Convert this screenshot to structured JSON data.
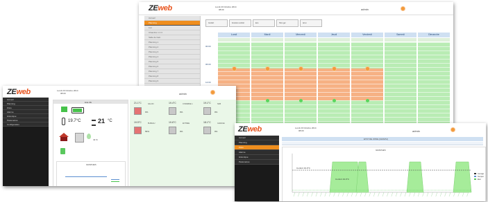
{
  "brand": {
    "ze": "ZE",
    "web": "web"
  },
  "colors": {
    "accent_orange": "#ef8e1e",
    "comfort_green": "#b9ecb4",
    "eco_orange": "#f6b184",
    "nav_dark": "#1a1a1a",
    "header_blue": "#cfe0f2"
  },
  "planning_screen": {
    "header_date": "Lundi 20 Octobre 2014",
    "header_time": "08:09",
    "user": "admin",
    "sidebar_items": [
      "Accueil",
      "Planning",
      "Lun",
      "Chambre 1 2 3",
      "Salle de bain",
      "Planning 1",
      "Planning 2",
      "Planning 3",
      "Planning 4",
      "Planning 5",
      "Planning 6",
      "Planning 7",
      "Planning 8",
      "Planning 9"
    ],
    "toolbar_buttons": [
      "Confort",
      "Fonction confort",
      "Eco",
      "Hors gel",
      "Arret"
    ],
    "days": [
      "Lundi",
      "Mardi",
      "Mercredi",
      "Jeudi",
      "Vendredi",
      "Samedi",
      "Dimanche"
    ],
    "hour_labels": [
      "00:00",
      "06:00",
      "12:00",
      "18:00"
    ]
  },
  "dashboard_screen": {
    "header_date": "Lundi 20 Octobre 2014",
    "header_time": "08:09",
    "user": "admin",
    "sidebar_items": [
      "Accueil",
      "Planning",
      "Zone",
      "Alarme",
      "Historique",
      "Parametres",
      "Configuration"
    ],
    "status_title": "Etat ZE",
    "indoor_temp": "19.7°C",
    "setpoint_value": "21",
    "setpoint_unit": "°C",
    "humidity": "42 %",
    "chart_title": "GRAPHES",
    "rooms": [
      {
        "name": "SALON",
        "temp": "21.1°C",
        "state": "0%",
        "heating": true
      },
      {
        "name": "CHAMBRE 1",
        "temp": "19.4°C",
        "state": "0%",
        "heating": false
      },
      {
        "name": "SDB",
        "temp": "19.1°C",
        "state": "0%",
        "heating": false
      },
      {
        "name": "BUREAU",
        "temp": "19.5°C",
        "state": "56%",
        "heating": true
      },
      {
        "name": "ENTREE",
        "temp": "19.6°C",
        "state": "0%",
        "heating": false
      },
      {
        "name": "GARAGE",
        "temp": "18.1°C",
        "state": "0%",
        "heating": false
      }
    ]
  },
  "graph_screen": {
    "header_date": "Lundi 20 Octobre 2014",
    "header_time": "08:09",
    "user": "admin",
    "sidebar_items": [
      "Accueil",
      "Planning",
      "Zone",
      "Alarme",
      "Historique",
      "Parametres"
    ],
    "title": "ETAT DE ZONE (GRAPH)",
    "chart_title": "GRAPHES",
    "tooltip": "Confort 19.0°C",
    "legend": [
      "Consigne",
      "Temperature",
      "Etat"
    ]
  }
}
